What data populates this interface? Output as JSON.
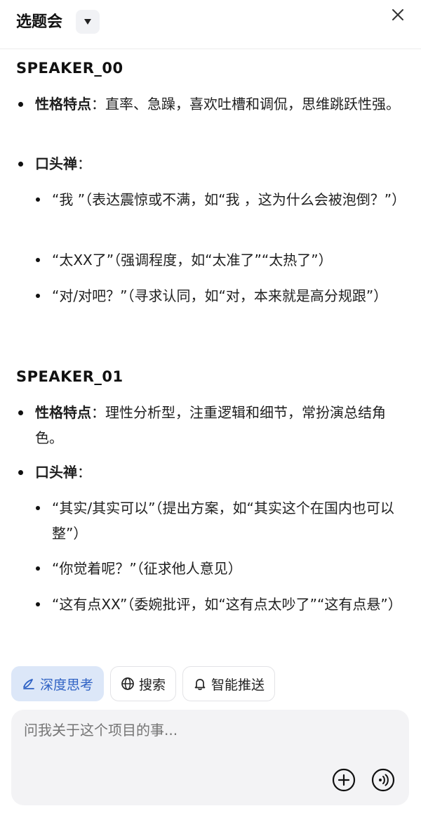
{
  "header": {
    "title": "选题会"
  },
  "speakers": [
    {
      "name": "SPEAKER_00",
      "personality_label": "性格特点",
      "personality_text": "：直率、急躁，喜欢吐槽和调侃，思维跳跃性强。",
      "catchphrase_label": "口头禅",
      "catchphrase_colon": "：",
      "catchphrases": [
        "“我 ”（表达震惊或不满，如“我 ，这为什么会被泡倒？”）",
        "“太XX了”（强调程度，如“太准了”“太热了”）",
        "“对/对吧？”（寻求认同，如“对，本来就是高分规跟”）"
      ]
    },
    {
      "name": "SPEAKER_01",
      "personality_label": "性格特点",
      "personality_text": "：理性分析型，注重逻辑和细节，常扮演总结角色。",
      "catchphrase_label": "口头禅",
      "catchphrase_colon": "：",
      "catchphrases": [
        "“其实/其实可以”（提出方案，如“其实这个在国内也可以整”）",
        "“你觉着呢？”（征求他人意见）",
        "“这有点XX”（委婉批评，如“这有点太吵了”“这有点悬”）"
      ]
    }
  ],
  "chips": [
    {
      "label": "深度思考",
      "icon": "deep-think-icon",
      "active": true
    },
    {
      "label": "搜索",
      "icon": "globe-icon",
      "active": false
    },
    {
      "label": "智能推送",
      "icon": "bell-icon",
      "active": false
    }
  ],
  "composer": {
    "placeholder": "问我关于这个项目的事..."
  },
  "colors": {
    "accent": "#2f62c4",
    "chip_active_bg": "#dce7f8",
    "composer_bg": "#f3f3f5"
  }
}
